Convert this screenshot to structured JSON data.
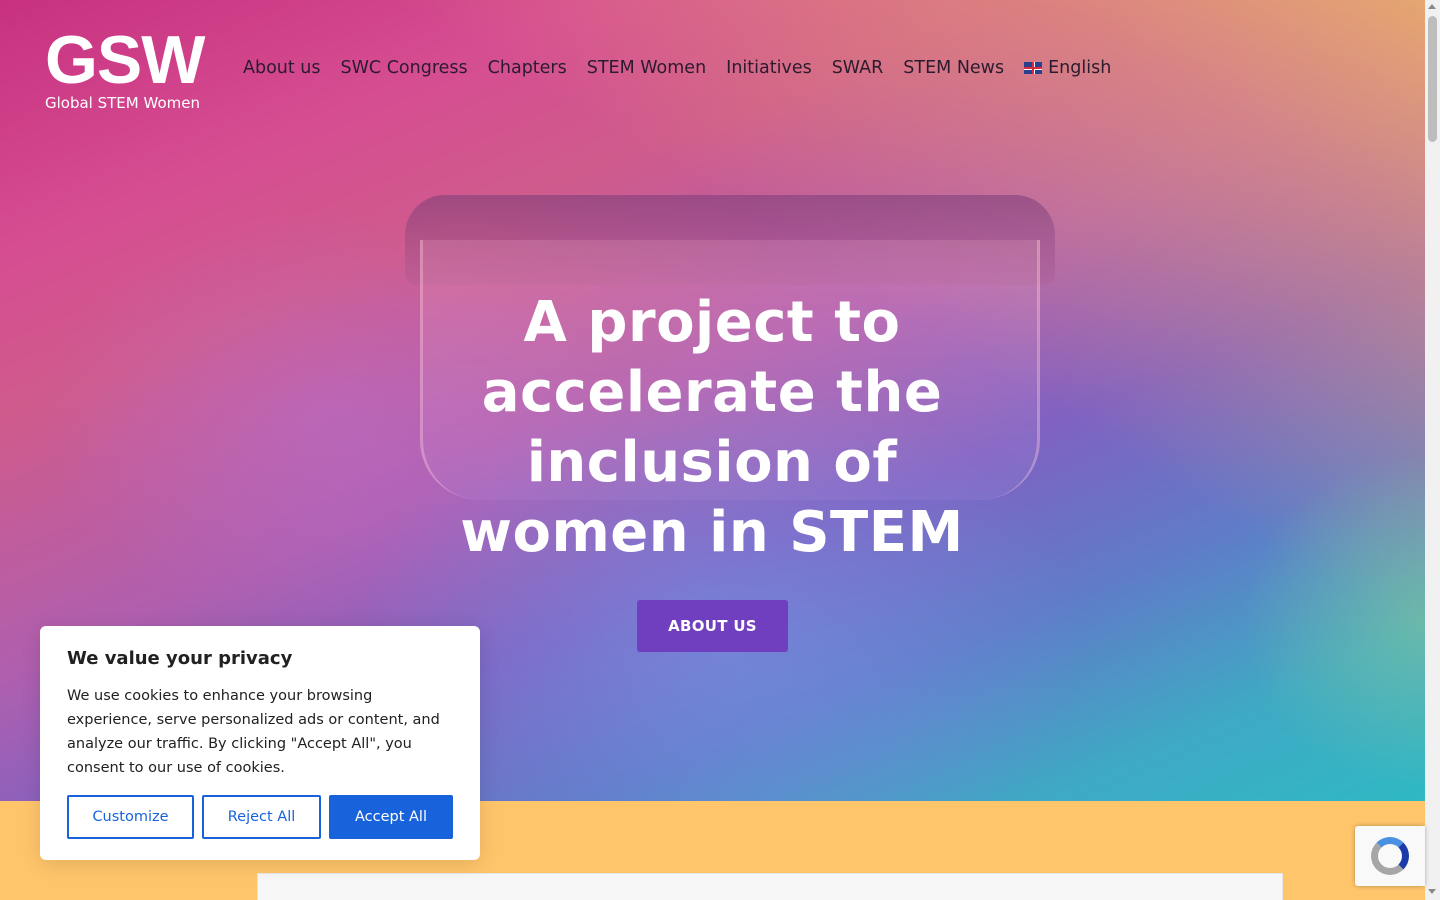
{
  "logo": {
    "mark": "GSW",
    "subtitle": "Global STEM Women"
  },
  "nav": {
    "items": [
      {
        "label": "About us"
      },
      {
        "label": "SWC Congress"
      },
      {
        "label": "Chapters"
      },
      {
        "label": "STEM Women"
      },
      {
        "label": "Initiatives"
      },
      {
        "label": "SWAR"
      },
      {
        "label": "STEM News"
      }
    ],
    "language": {
      "label": "English",
      "icon": "uk-flag-icon"
    }
  },
  "hero": {
    "headline": "A project to accelerate the inclusion of women in STEM",
    "cta_label": "ABOUT US"
  },
  "cookie": {
    "title": "We value your privacy",
    "text": "We use cookies to enhance your browsing experience, serve personalized ads or content, and analyze our traffic. By clicking \"Accept All\", you consent to our use of cookies.",
    "customize_label": "Customize",
    "reject_label": "Reject All",
    "accept_label": "Accept All"
  },
  "colors": {
    "cta_bg": "#6f3fbf",
    "cookie_accent": "#1863dc",
    "band_bg": "#ffc56b"
  },
  "icons": {
    "recaptcha": "recaptcha-icon"
  }
}
